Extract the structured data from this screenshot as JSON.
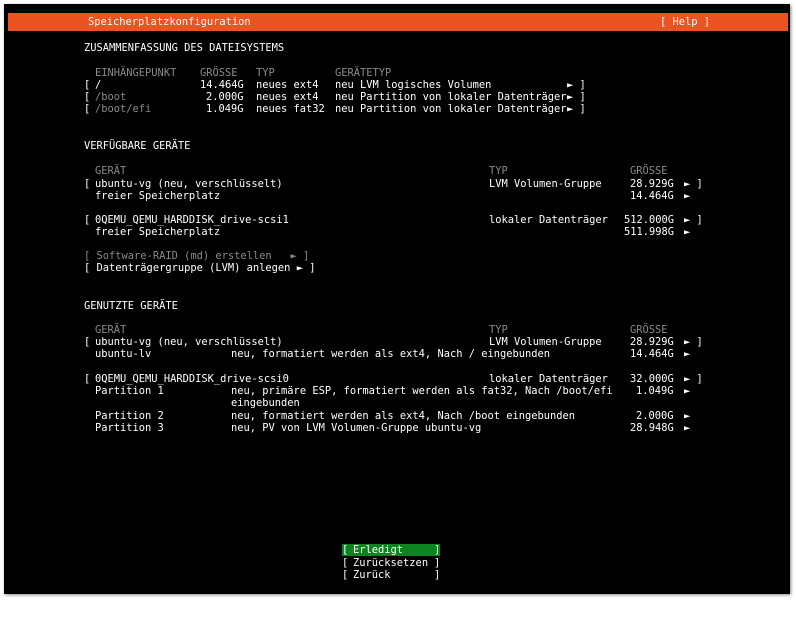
{
  "header": {
    "title": "Speicherplatzkonfiguration",
    "help": "[ Help ]"
  },
  "fs_summary": {
    "heading": "ZUSAMMENFASSUNG DES DATEISYSTEMS",
    "columns": [
      "EINHÄNGEPUNKT",
      "GRÖSSE",
      "TYP",
      "GERÄTETYP"
    ],
    "rows": [
      {
        "open": "[",
        "mount": "/",
        "size": "14.464G",
        "type": "neues ext4",
        "devtype": "neu LVM logisches Volumen",
        "close": "► ]"
      },
      {
        "open": "[",
        "mount": "/boot",
        "size": "2.000G",
        "type": "neues ext4",
        "devtype": "neu Partition von lokaler Datenträger",
        "close": "► ]"
      },
      {
        "open": "[",
        "mount": "/boot/efi",
        "size": "1.049G",
        "type": "neues fat32",
        "devtype": "neu Partition von lokaler Datenträger",
        "close": "► ]"
      }
    ]
  },
  "available": {
    "heading": "VERFÜGBARE GERÄTE",
    "columns": [
      "GERÄT",
      "TYP",
      "GRÖSSE"
    ],
    "rows": [
      {
        "open": "[",
        "device": "ubuntu-vg (neu, verschlüsselt)",
        "type": "LVM Volumen-Gruppe",
        "size": "28.929G",
        "close": "► ]"
      },
      {
        "open": "",
        "device": "freier Speicherplatz",
        "type": "",
        "size": "14.464G",
        "close": "►"
      },
      {
        "open": "[",
        "device": "0QEMU_QEMU_HARDDISK_drive-scsi1",
        "type": "lokaler Datenträger",
        "size": "512.000G",
        "close": "► ]"
      },
      {
        "open": "",
        "device": "freier Speicherplatz",
        "type": "",
        "size": "511.998G",
        "close": "►"
      }
    ],
    "actions": [
      {
        "label": "[ Software-RAID (md) erstellen   ► ]"
      },
      {
        "label": "[ Datenträgergruppe (LVM) anlegen ► ]"
      }
    ]
  },
  "used": {
    "heading": "GENUTZTE GERÄTE",
    "columns": [
      "GERÄT",
      "TYP",
      "GRÖSSE"
    ],
    "rows": [
      {
        "open": "[",
        "device": "ubuntu-vg (neu, verschlüsselt)",
        "desc": "",
        "type": "LVM Volumen-Gruppe",
        "size": "28.929G",
        "close": "► ]"
      },
      {
        "open": "",
        "device": "ubuntu-lv",
        "desc": "neu, formatiert werden als ext4, Nach / eingebunden",
        "type": "",
        "size": "14.464G",
        "close": "►"
      },
      {
        "open": "[",
        "device": "0QEMU_QEMU_HARDDISK_drive-scsi0",
        "desc": "",
        "type": "lokaler Datenträger",
        "size": "32.000G",
        "close": "► ]"
      },
      {
        "open": "",
        "device": "Partition 1",
        "desc": "neu, primäre ESP, formatiert werden als fat32, Nach /boot/efi",
        "desc2": "eingebunden",
        "type": "",
        "size": "1.049G",
        "close": "►"
      },
      {
        "open": "",
        "device": "Partition 2",
        "desc": "neu, formatiert werden als ext4, Nach /boot eingebunden",
        "type": "",
        "size": "2.000G",
        "close": "►"
      },
      {
        "open": "",
        "device": "Partition 3",
        "desc": "neu, PV von LVM Volumen-Gruppe ubuntu-vg",
        "type": "",
        "size": "28.948G",
        "close": "►"
      }
    ]
  },
  "buttons": [
    {
      "open": "[",
      "label": "Erledigt",
      "close": "]",
      "selected": true
    },
    {
      "open": "[",
      "label": "Zurücksetzen",
      "close": "]",
      "selected": false
    },
    {
      "open": "[",
      "label": "Zurück",
      "close": "]",
      "selected": false
    }
  ],
  "colors": {
    "header_bg": "#e95420",
    "selected_bg": "#0e8420",
    "screen_bg": "#000000",
    "dim_text": "#8a8a8a"
  }
}
